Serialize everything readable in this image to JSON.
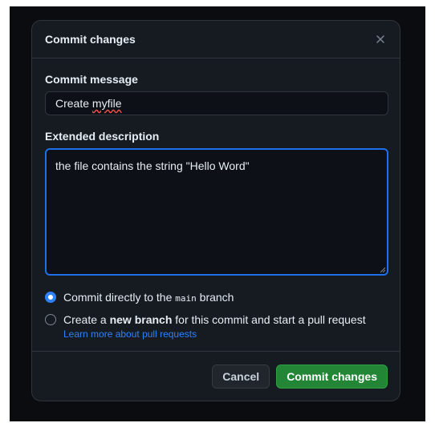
{
  "dialog": {
    "title": "Commit changes",
    "close_icon": "close-icon"
  },
  "commit_message": {
    "label": "Commit message",
    "value_prefix": "Create ",
    "value_misspelled": "myfile"
  },
  "extended_description": {
    "label": "Extended description",
    "value": "the file contains the string \"Hello Word\""
  },
  "options": {
    "direct": {
      "prefix": "Commit directly to the ",
      "branch": "main",
      "suffix": " branch",
      "checked": true
    },
    "new_branch": {
      "prefix": "Create a ",
      "bold": "new branch",
      "suffix": " for this commit and start a pull request",
      "checked": false
    },
    "learn_more": "Learn more about pull requests"
  },
  "footer": {
    "cancel_label": "Cancel",
    "commit_label": "Commit changes"
  },
  "colors": {
    "accent": "#2f81f7",
    "primary_button": "#238636",
    "background": "#161b22"
  }
}
